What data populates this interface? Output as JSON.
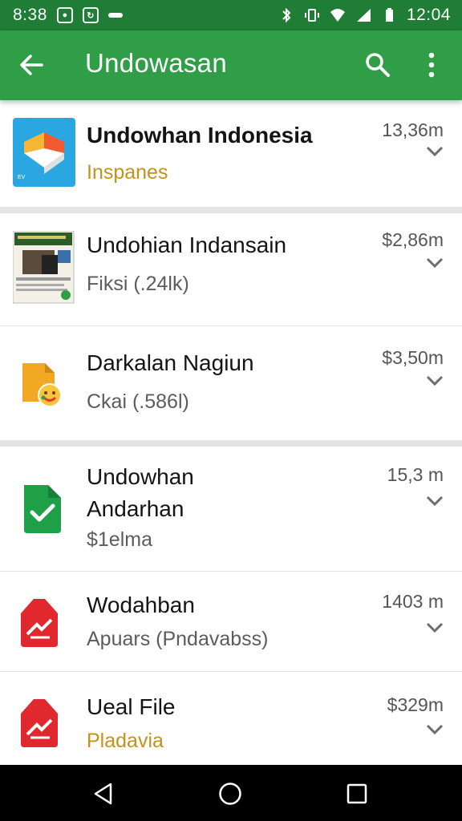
{
  "status_bar": {
    "left_time": "8:38",
    "notif_icons": [
      "camera-notification-icon",
      "app-notification-icon",
      "more-notifications-icon"
    ],
    "right_icons": [
      "bluetooth-icon",
      "vibrate-icon",
      "wifi-icon",
      "signal-icon",
      "battery-icon"
    ],
    "clock": "12:04"
  },
  "app_bar": {
    "title": "Undowasan",
    "color": "#2f9e47",
    "status_color": "#1f7d36"
  },
  "items": [
    {
      "title": "Undowhan Indonesia",
      "subtitle": "Inspanes",
      "subtitle_color": "#c4911a",
      "meta": "13,36m",
      "icon": "blue-cube-app-icon"
    },
    {
      "title": "Undohian Indansain",
      "subtitle": "Fiksi (.24lk)",
      "meta": "$2,86m",
      "icon": "book-cover-thumbnail"
    },
    {
      "title": "Darkalan Nagiun",
      "subtitle": "Ckai (.586l)",
      "meta": "$3,50m",
      "icon": "orange-file-emoji-icon"
    },
    {
      "title_line1": "Undowhan",
      "title_line2": "Andarhan",
      "subtitle": "$1elma",
      "meta": "15,3 m",
      "icon": "green-file-check-icon"
    },
    {
      "title": "Wodahban",
      "subtitle": "Apuars (Pndavabss)",
      "meta": "1403 m",
      "icon": "red-pdf-file-icon"
    },
    {
      "title": "Ueal File",
      "subtitle": "Pladavia",
      "subtitle_color": "#c4911a",
      "meta": "$329m",
      "icon": "red-pdf-file-icon"
    }
  ],
  "nav_bar": [
    "back-nav-icon",
    "home-nav-icon",
    "recents-nav-icon"
  ]
}
